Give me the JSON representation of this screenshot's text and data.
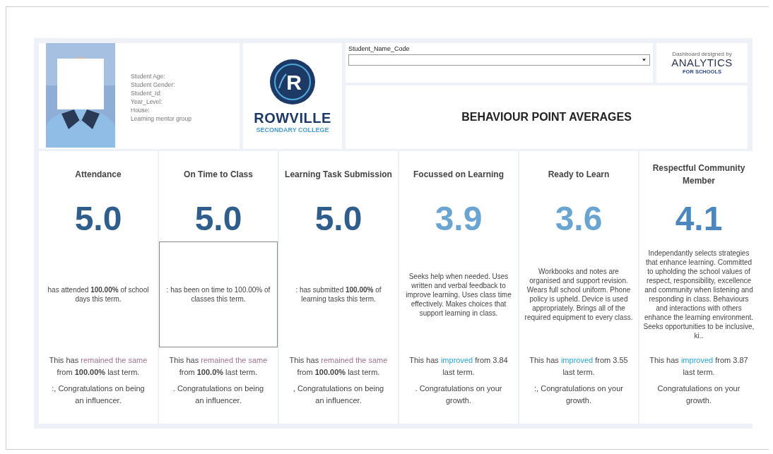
{
  "student_panel": {
    "fields": [
      "Student Age:",
      "Student Gender:",
      "Student_Id:",
      "Year_Level:",
      "House:",
      "Learning mentor group"
    ]
  },
  "school_logo": {
    "letter": "R",
    "name": "ROWVILLE",
    "subtitle": "SECONDARY COLLEGE"
  },
  "selector": {
    "label": "Student_Name_Code"
  },
  "credit": {
    "text": "Dashboard designed by",
    "brand": "ANALYTICS",
    "brand_subtitle": "FOR SCHOOLS"
  },
  "title": "BEHAVIOUR POINT AVERAGES",
  "cards": [
    {
      "title": "Attendance",
      "score": "5.0",
      "color": "#2f5e8c",
      "selected": false,
      "description": "has attended **100.00%** of school days this term.",
      "change": {
        "color": "#a2728f",
        "before": "This has",
        "word": "remained the same",
        "after": "from **100.00%** last term."
      },
      "note": ":,  Congratulations on being an influencer."
    },
    {
      "title": "On Time to Class",
      "score": "5.0",
      "color": "#2f5e8c",
      "selected": true,
      "description": ": has been on time to 100.00% of classes this term.",
      "change": {
        "color": "#a2728f",
        "before": "This has",
        "word": "remained the same",
        "after": "from **100.0%** last term."
      },
      "note": ". Congratulations on being an influencer."
    },
    {
      "title": "Learning Task Submission",
      "score": "5.0",
      "color": "#2f5e8c",
      "selected": false,
      "description": ": has submitted **100.00%** of learning tasks this term.",
      "change": {
        "color": "#a2728f",
        "before": "This has",
        "word": "remained the same",
        "after": "from **100.00%** last term."
      },
      "note": ", Congratulations on being an influencer."
    },
    {
      "title": "Focussed on Learning",
      "score": "3.9",
      "color": "#6aa5d2",
      "selected": false,
      "description": "Seeks help when needed. Uses written and verbal feedback to improve learning. Uses class time effectively. Makes choices that support learning in class.",
      "change": {
        "color": "#2aa6d6",
        "before": "This has",
        "word": "improved",
        "after": "from 3.84 last term."
      },
      "note": ". Congratulations on your growth."
    },
    {
      "title": "Ready to Learn",
      "score": "3.6",
      "color": "#6aa5d2",
      "selected": false,
      "description": "Workbooks and notes are organised and support revision. Wears full school uniform. Phone policy is upheld. Device is used appropriately. Brings all of the required equipment to every class.",
      "change": {
        "color": "#2aa6d6",
        "before": "This has",
        "word": "improved",
        "after": "from 3.55 last term."
      },
      "note": ":, Congratulations on your growth."
    },
    {
      "title": "Respectful Community Member",
      "score": "4.1",
      "color": "#4c88bd",
      "selected": false,
      "description": "Independantly selects strategies that enhance learning. Committed to upholding the school values of respect, responsibility, excellence and community when listening and responding in class. Behaviours and interactions with others enhance the learning environment. Seeks opportunities to be inclusive, ki..",
      "change": {
        "color": "#2aa6d6",
        "before": "This has",
        "word": "improved",
        "after": "from 3.87 last term."
      },
      "note": "Congratulations on your growth."
    }
  ]
}
